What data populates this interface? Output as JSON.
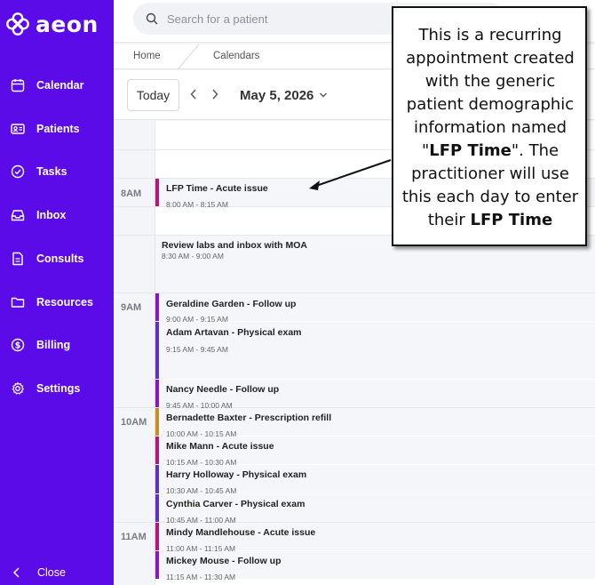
{
  "brand": {
    "name": "aeon"
  },
  "sidebar": {
    "items": [
      {
        "label": "Calendar",
        "icon": "calendar-icon"
      },
      {
        "label": "Patients",
        "icon": "id-card-icon"
      },
      {
        "label": "Tasks",
        "icon": "check-circle-icon"
      },
      {
        "label": "Inbox",
        "icon": "inbox-icon"
      },
      {
        "label": "Consults",
        "icon": "document-icon"
      },
      {
        "label": "Resources",
        "icon": "folder-icon"
      },
      {
        "label": "Billing",
        "icon": "dollar-icon"
      },
      {
        "label": "Settings",
        "icon": "gear-icon"
      }
    ],
    "close_label": "Close"
  },
  "search": {
    "placeholder": "Search for a patient"
  },
  "breadcrumb": {
    "home": "Home",
    "current": "Calendars"
  },
  "toolbar": {
    "today_label": "Today",
    "date": "May 5, 2026"
  },
  "calendar": {
    "hours": [
      "8AM",
      "9AM",
      "10AM",
      "11AM"
    ],
    "events": [
      {
        "title": "LFP Time - Acute issue",
        "time": "8:00 AM - 8:15 AM",
        "color": "#c0107a"
      },
      {
        "title": "Review labs and inbox with MOA",
        "time": "8:30 AM - 9:00 AM",
        "color": ""
      },
      {
        "title": "Geraldine Garden - Follow up",
        "time": "9:00 AM - 9:15 AM",
        "color": "#8a12d4"
      },
      {
        "title": "Adam Artavan - Physical exam",
        "time": "9:15 AM - 9:45 AM",
        "color": "#5a2fd6"
      },
      {
        "title": "Nancy Needle - Follow up",
        "time": "9:45 AM - 10:00 AM",
        "color": "#8a12d4"
      },
      {
        "title": "Bernadette Baxter - Prescription refill",
        "time": "10:00 AM - 10:15 AM",
        "color": "#c8901a"
      },
      {
        "title": "Mike Mann - Acute issue",
        "time": "10:15 AM - 10:30 AM",
        "color": "#c0107a"
      },
      {
        "title": "Harry Holloway - Physical exam",
        "time": "10:30 AM - 10:45 AM",
        "color": "#5a2fd6"
      },
      {
        "title": "Cynthia Carver - Physical exam",
        "time": "10:45 AM - 11:00 AM",
        "color": "#5a2fd6"
      },
      {
        "title": "Mindy Mandlehouse - Acute issue",
        "time": "11:00 AM - 11:15 AM",
        "color": "#c0107a"
      },
      {
        "title": "Mickey Mouse - Follow up",
        "time": "11:15 AM - 11:30 AM",
        "color": "#8a12d4"
      }
    ]
  },
  "callout": {
    "text_1": "This is a recurring appointment created with the generic patient demographic information named \"",
    "bold_1": "LFP Time",
    "text_2": "\".  The practitioner will use this each day to enter their ",
    "bold_2": "LFP Time"
  },
  "colors": {
    "sidebar": "#5b0be8",
    "acute": "#c0107a",
    "followup": "#8a12d4",
    "physical": "#5a2fd6",
    "refill": "#c8901a"
  }
}
